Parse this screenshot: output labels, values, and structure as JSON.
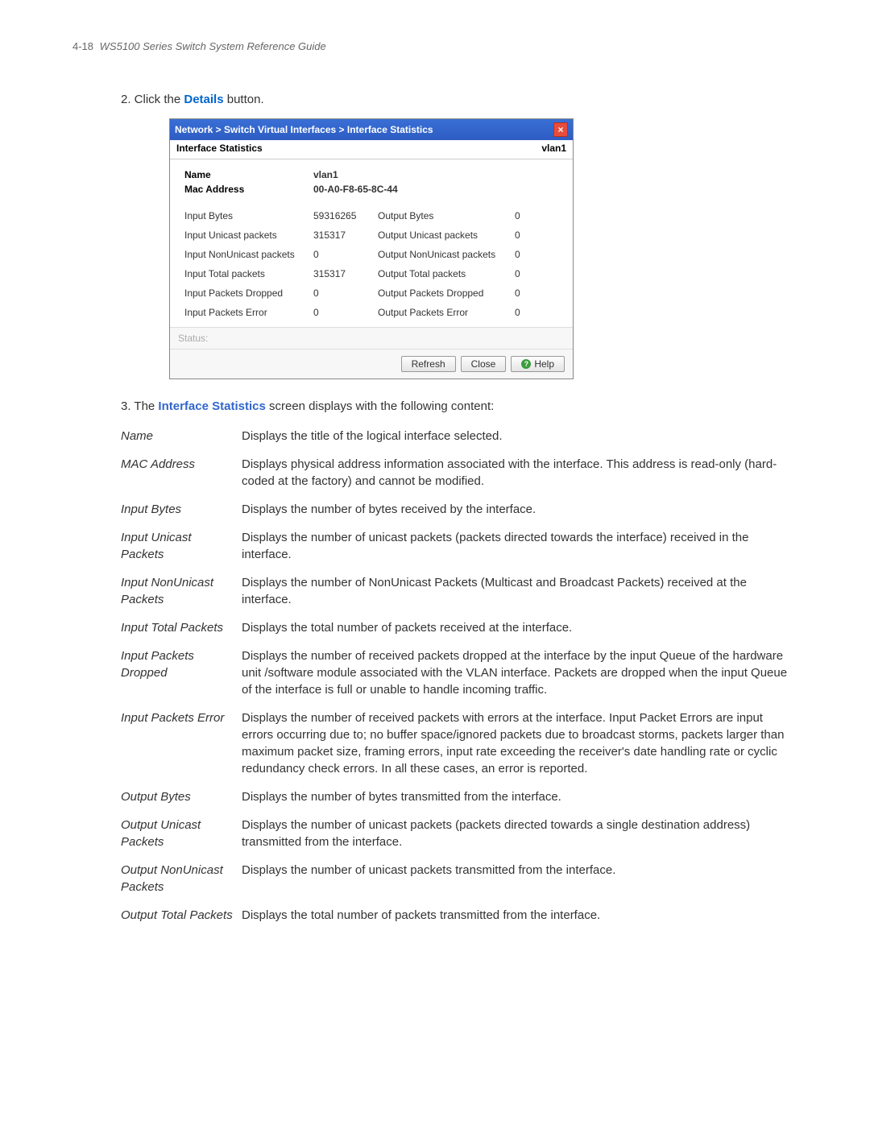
{
  "header": {
    "pageno": "4-18",
    "doc_title": "WS5100 Series Switch System Reference Guide"
  },
  "step2": {
    "prefix": "2. Click the ",
    "bold": "Details",
    "suffix": " button."
  },
  "dialog": {
    "breadcrumb": "Network > Switch Virtual Interfaces > Interface Statistics",
    "subheader_left": "Interface Statistics",
    "subheader_right": "vlan1",
    "name_label": "Name",
    "name_value": "vlan1",
    "mac_label": "Mac Address",
    "mac_value": "00-A0-F8-65-8C-44",
    "stats": [
      {
        "l1": "Input Bytes",
        "v1": "59316265",
        "l2": "Output Bytes",
        "v2": "0"
      },
      {
        "l1": "Input Unicast packets",
        "v1": "315317",
        "l2": "Output Unicast packets",
        "v2": "0"
      },
      {
        "l1": "Input NonUnicast packets",
        "v1": "0",
        "l2": "Output NonUnicast packets",
        "v2": "0"
      },
      {
        "l1": "Input Total packets",
        "v1": "315317",
        "l2": "Output Total packets",
        "v2": "0"
      },
      {
        "l1": "Input Packets Dropped",
        "v1": "0",
        "l2": "Output Packets Dropped",
        "v2": "0"
      },
      {
        "l1": "Input Packets Error",
        "v1": "0",
        "l2": "Output Packets Error",
        "v2": "0"
      }
    ],
    "status_label": "Status:",
    "btn_refresh": "Refresh",
    "btn_close": "Close",
    "btn_help": "Help"
  },
  "step3": {
    "prefix": "3. The ",
    "bold": "Interface Statistics",
    "suffix": " screen displays with the following content:"
  },
  "definitions": [
    {
      "term": "Name",
      "desc": "Displays the title of the logical interface selected."
    },
    {
      "term": "MAC Address",
      "desc": "Displays physical address information associated with the interface. This address is read-only (hard-coded at the factory) and cannot be modified."
    },
    {
      "term": "Input Bytes",
      "desc": "Displays the number of bytes received by the interface."
    },
    {
      "term": "Input Unicast Packets",
      "desc": "Displays the number of unicast packets (packets directed towards the interface) received in the interface."
    },
    {
      "term": "Input NonUnicast Packets",
      "desc": "Displays the number of NonUnicast Packets (Multicast and Broadcast Packets) received at the interface."
    },
    {
      "term": "Input Total Packets",
      "desc": "Displays the total number of packets received at the interface."
    },
    {
      "term": "Input Packets Dropped",
      "desc": "Displays the number of received packets dropped at the interface by the input Queue of the hardware unit /software module associated with the VLAN interface. Packets are dropped when the input Queue of the interface is full or unable to handle incoming traffic."
    },
    {
      "term": "Input Packets Error",
      "desc": "Displays the number of received packets with errors at the interface. Input Packet Errors are input errors occurring due to; no buffer space/ignored packets due to broadcast storms, packets larger than maximum packet size, framing errors, input rate exceeding the receiver's date handling rate or cyclic redundancy check errors. In all these cases, an error is reported."
    },
    {
      "term": "Output Bytes",
      "desc": "Displays the number of bytes transmitted from the interface."
    },
    {
      "term": "Output Unicast Packets",
      "desc": "Displays the number of unicast packets (packets directed towards a single destination address) transmitted from the interface."
    },
    {
      "term": "Output NonUnicast Packets",
      "desc": "Displays the number of unicast packets transmitted from the interface."
    },
    {
      "term": "Output Total Packets",
      "desc": "Displays the total number of packets transmitted from the interface."
    }
  ]
}
